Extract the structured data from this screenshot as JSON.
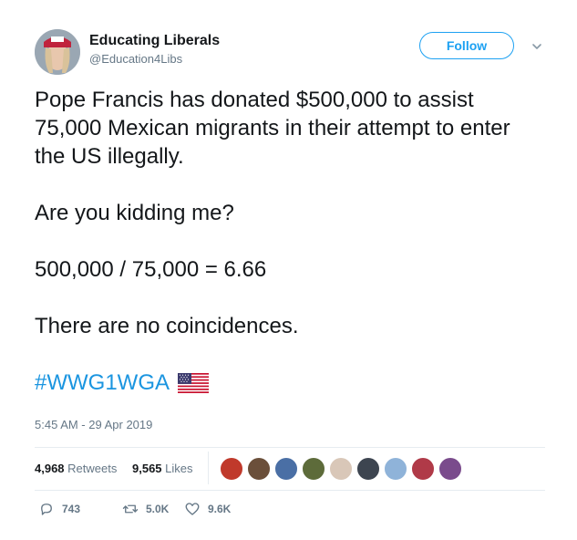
{
  "header": {
    "display_name": "Educating Liberals",
    "handle": "@Education4Libs",
    "follow_label": "Follow"
  },
  "tweet": {
    "lines": [
      "Pope Francis has donated $500,000 to assist 75,000 Mexican migrants in their attempt to enter the US illegally.",
      "Are you kidding me?",
      "500,000 / 75,000 = 6.66",
      "There are no coincidences."
    ],
    "hashtag": "#WWG1WGA",
    "timestamp": "5:45 AM - 29 Apr 2019"
  },
  "stats": {
    "retweets_count": "4,968",
    "retweets_label": "Retweets",
    "likes_count": "9,565",
    "likes_label": "Likes"
  },
  "actions": {
    "replies": "743",
    "retweets": "5.0K",
    "likes": "9.6K"
  },
  "colors": {
    "accent": "#1da1f2",
    "hashtag": "#1b95e0",
    "muted": "#657786"
  }
}
